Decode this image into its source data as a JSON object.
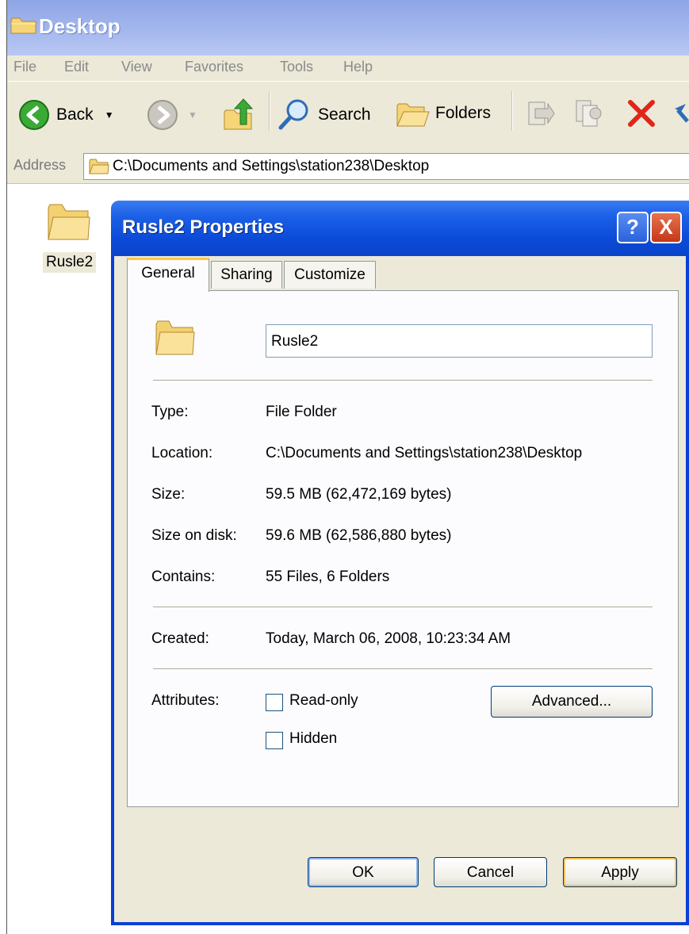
{
  "explorer": {
    "title": "Desktop",
    "menu": [
      "File",
      "Edit",
      "View",
      "Favorites",
      "Tools",
      "Help"
    ],
    "toolbar": {
      "back_label": "Back",
      "search_label": "Search",
      "folders_label": "Folders"
    },
    "address": {
      "label": "Address",
      "path": "C:\\Documents and Settings\\station238\\Desktop"
    },
    "desktop_item": {
      "label": "Rusle2"
    }
  },
  "dialog": {
    "title": "Rusle2 Properties",
    "help_glyph": "?",
    "close_glyph": "X",
    "tabs": [
      "General",
      "Sharing",
      "Customize"
    ],
    "active_tab": "General",
    "name_value": "Rusle2",
    "rows": {
      "type": {
        "label": "Type:",
        "value": "File Folder"
      },
      "location": {
        "label": "Location:",
        "value": "C:\\Documents and Settings\\station238\\Desktop"
      },
      "size": {
        "label": "Size:",
        "value": "59.5 MB (62,472,169 bytes)"
      },
      "size_disk": {
        "label": "Size on disk:",
        "value": "59.6 MB (62,586,880 bytes)"
      },
      "contains": {
        "label": "Contains:",
        "value": "55 Files, 6 Folders"
      },
      "created": {
        "label": "Created:",
        "value": "Today, March 06, 2008, 10:23:34 AM"
      }
    },
    "attributes": {
      "label": "Attributes:",
      "read_only": {
        "label": "Read-only",
        "checked": false
      },
      "hidden": {
        "label": "Hidden",
        "checked": false
      },
      "advanced_label": "Advanced..."
    },
    "buttons": {
      "ok": "OK",
      "cancel": "Cancel",
      "apply": "Apply"
    }
  },
  "colors": {
    "titlebar_active": "#0b4ad8",
    "titlebar_inactive": "#a4b7ee",
    "face": "#ece9d8",
    "tab_highlight": "#ffc83c",
    "close_red": "#c4381a"
  }
}
